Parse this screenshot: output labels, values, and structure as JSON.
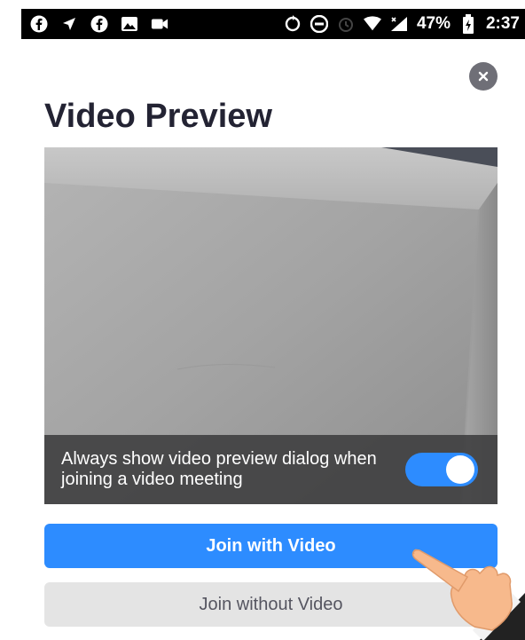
{
  "status_bar": {
    "left_icons": [
      "facebook-icon",
      "location-arrow-icon",
      "facebook-icon",
      "image-icon",
      "video-camera-icon"
    ],
    "right_icons": [
      "sync-icon",
      "do-not-disturb-icon",
      "alarm-icon",
      "wifi-icon",
      "signal-icon",
      "battery-icon"
    ],
    "battery_percent": "47%",
    "time": "2:37"
  },
  "dialog": {
    "title": "Video Preview",
    "close_icon": "close-icon",
    "toggle": {
      "label": "Always show video preview dialog when joining a video meeting",
      "checked": true
    },
    "join_with_video_label": "Join with Video",
    "join_without_video_label": "Join without Video"
  },
  "colors": {
    "accent": "#2d8cff",
    "secondary_button": "#e4e4e4",
    "title_text": "#232333"
  }
}
